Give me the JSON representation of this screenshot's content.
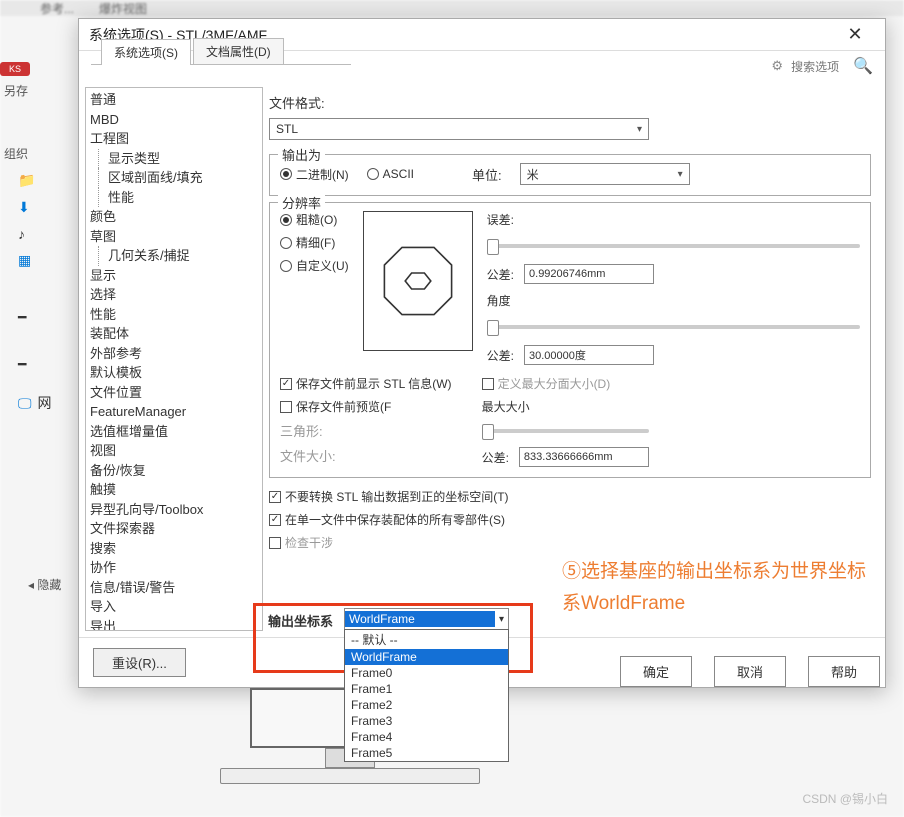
{
  "bg_tabs": {
    "a": "参考...",
    "b": "爆炸视图"
  },
  "left_stub": {
    "ks": "KS",
    "other": "另存",
    "org": "组织",
    "hide": "◂ 隐藏"
  },
  "dialog": {
    "title": "系统选项(S) - STL/3MF/AMF",
    "search_placeholder": "搜索选项",
    "tabs": {
      "sys": "系统选项(S)",
      "doc": "文档属性(D)"
    }
  },
  "tree": [
    "普通",
    "MBD",
    "工程图",
    {
      "sub": [
        "显示类型",
        "区域剖面线/填充",
        "性能"
      ]
    },
    "颜色",
    "草图",
    {
      "sub": [
        "几何关系/捕捉"
      ]
    },
    "显示",
    "选择",
    "性能",
    "装配体",
    "外部参考",
    "默认模板",
    "文件位置",
    "FeatureManager",
    "选值框增量值",
    "视图",
    "备份/恢复",
    "触摸",
    "异型孔向导/Toolbox",
    "文件探索器",
    "搜索",
    "协作",
    "信息/错误/警告",
    "导入",
    "导出"
  ],
  "main": {
    "file_format_lbl": "文件格式:",
    "file_format_val": "STL",
    "output_as": "输出为",
    "binary": "二进制(N)",
    "ascii": "ASCII",
    "unit_lbl": "单位:",
    "unit_val": "米",
    "resolution": "分辨率",
    "coarse": "粗糙(O)",
    "fine": "精细(F)",
    "custom": "自定义(U)",
    "error_lbl": "误差:",
    "tol1_lbl": "公差:",
    "tol1_val": "0.99206746mm",
    "angle_lbl": "角度",
    "tol2_lbl": "公差:",
    "tol2_val": "30.00000度",
    "chk_show_stl": "保存文件前显示 STL 信息(W)",
    "chk_define_max": "定义最大分面大小(D)",
    "chk_preview": "保存文件前预览(F",
    "max_size": "最大大小",
    "tri": "三角形:",
    "fsize": "文件大小:",
    "tol3_lbl": "公差:",
    "tol3_val": "833.33666666mm",
    "chk_no_convert": "不要转换 STL 输出数据到正的坐标空间(T)",
    "chk_single_file": "在单一文件中保存装配体的所有零部件(S)",
    "chk_check": "检查干涉",
    "coord_lbl": "输出坐标系",
    "coord_selected": "WorldFrame",
    "reset_btn": "重设(R)..."
  },
  "dropdown": [
    "-- 默认 --",
    "WorldFrame",
    "Frame0",
    "Frame1",
    "Frame2",
    "Frame3",
    "Frame4",
    "Frame5"
  ],
  "footer": {
    "ok": "确定",
    "cancel": "取消",
    "help": "帮助"
  },
  "annotation": "⑤选择基座的输出坐标系为世界坐标系WorldFrame",
  "watermark": "CSDN @锡小白"
}
